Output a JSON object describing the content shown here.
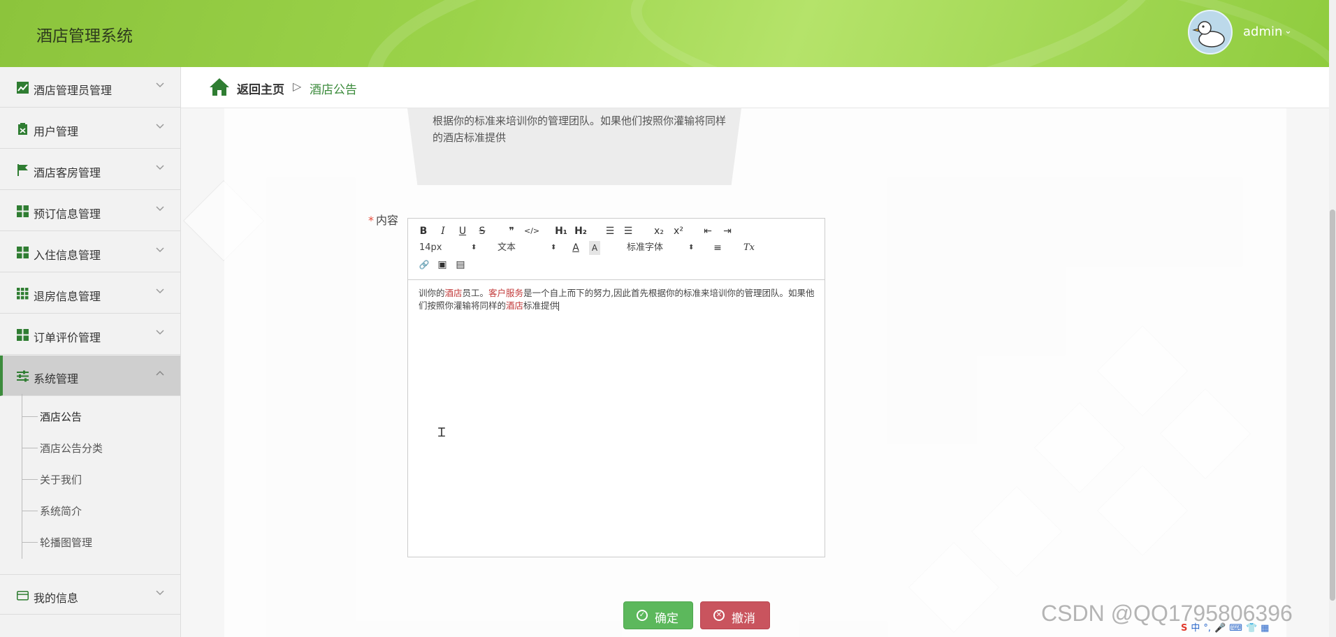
{
  "app": {
    "title": "酒店管理系统"
  },
  "user": {
    "name": "admin",
    "caret": "⌄"
  },
  "sidebar": {
    "items": [
      {
        "label": "酒店管理员管理",
        "icon": "chart-icon"
      },
      {
        "label": "用户管理",
        "icon": "clipboard-icon"
      },
      {
        "label": "酒店客房管理",
        "icon": "flag-icon"
      },
      {
        "label": "预订信息管理",
        "icon": "grid-icon"
      },
      {
        "label": "入住信息管理",
        "icon": "grid-icon"
      },
      {
        "label": "退房信息管理",
        "icon": "grid-9-icon"
      },
      {
        "label": "订单评价管理",
        "icon": "grid-icon"
      },
      {
        "label": "系统管理",
        "icon": "sliders-icon",
        "expanded": true
      },
      {
        "label": "我的信息",
        "icon": "card-icon"
      }
    ],
    "submenu": [
      {
        "label": "酒店公告",
        "current": true
      },
      {
        "label": "酒店公告分类"
      },
      {
        "label": "关于我们"
      },
      {
        "label": "系统简介"
      },
      {
        "label": "轮播图管理"
      }
    ]
  },
  "breadcrumb": {
    "home": "返回主页",
    "separator": "▷",
    "current": "酒店公告"
  },
  "form": {
    "preview_text": "根据你的标准来培训你的管理团队。如果他们按照你灌输将同样的酒店标准提供",
    "content_label": "内容",
    "required_mark": "*"
  },
  "editor": {
    "toolbar": {
      "bold": "B",
      "italic": "I",
      "underline": "U",
      "strike": "S",
      "quote": "❞",
      "code": "</>",
      "h1": "H₁",
      "h2": "H₂",
      "ordered_list": "☰",
      "bullet_list": "☰",
      "subscript": "x₂",
      "superscript": "x²",
      "outdent": "⇤",
      "indent": "⇥",
      "size": "14px",
      "header": "文本",
      "font": "标准字体",
      "color": "A",
      "background": "A",
      "align": "≡",
      "clean": "Tx",
      "link": "🔗",
      "image": "▣",
      "video": "▤"
    },
    "content": {
      "p1": "训你的",
      "hl1": "酒店",
      "p2": "员工。",
      "hl2": "客户服务",
      "p3": "是一个自上而下的努力,因此首先根据你的标准来培训你的管理团队。如果他们按照你灌输将同样的",
      "hl3": "酒店",
      "p4": "标准提供"
    }
  },
  "buttons": {
    "confirm": "确定",
    "cancel": "撤消"
  },
  "watermark": "CSDN @QQ1795806396",
  "colors": {
    "primary": "#5cb85c",
    "danger": "#c9545e",
    "header": "#9bd34a",
    "accent": "#3a8a3a"
  }
}
